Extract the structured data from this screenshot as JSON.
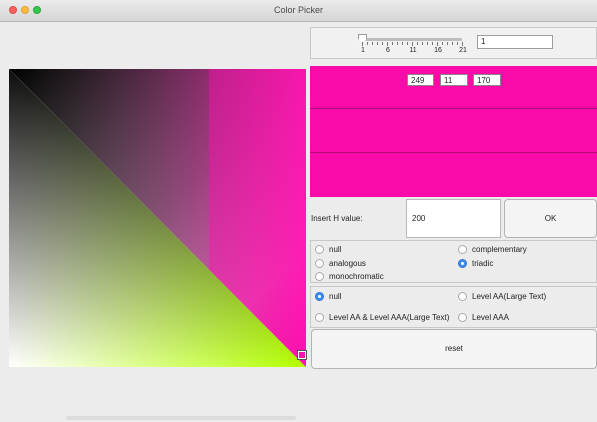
{
  "window": {
    "title": "Color Picker"
  },
  "slider": {
    "value": 1,
    "min": 1,
    "max": 21,
    "tick_labels": [
      "1",
      "6",
      "11",
      "16",
      "21"
    ],
    "input_value": "1"
  },
  "swatch": {
    "color": "#f90baa",
    "r": "249",
    "g": "11",
    "b": "170"
  },
  "hue_input": {
    "label": "Insert H value:",
    "value": "200",
    "ok_label": "OK"
  },
  "harmony": {
    "options": [
      {
        "label": "null",
        "selected": false
      },
      {
        "label": "complementary",
        "selected": false
      },
      {
        "label": "analogous",
        "selected": false
      },
      {
        "label": "triadic",
        "selected": true
      },
      {
        "label": "monochromatic",
        "selected": false
      }
    ]
  },
  "contrast": {
    "options": [
      {
        "label": "null",
        "selected": true
      },
      {
        "label": "Level AA(Large Text)",
        "selected": false
      },
      {
        "label": "Level AA & Level AAA(Large Text)",
        "selected": false
      },
      {
        "label": "Level AAA",
        "selected": false
      }
    ]
  },
  "reset_label": "reset",
  "colors": {
    "field_corner": "#ff0fb0",
    "field_green": "#b4ff00"
  }
}
